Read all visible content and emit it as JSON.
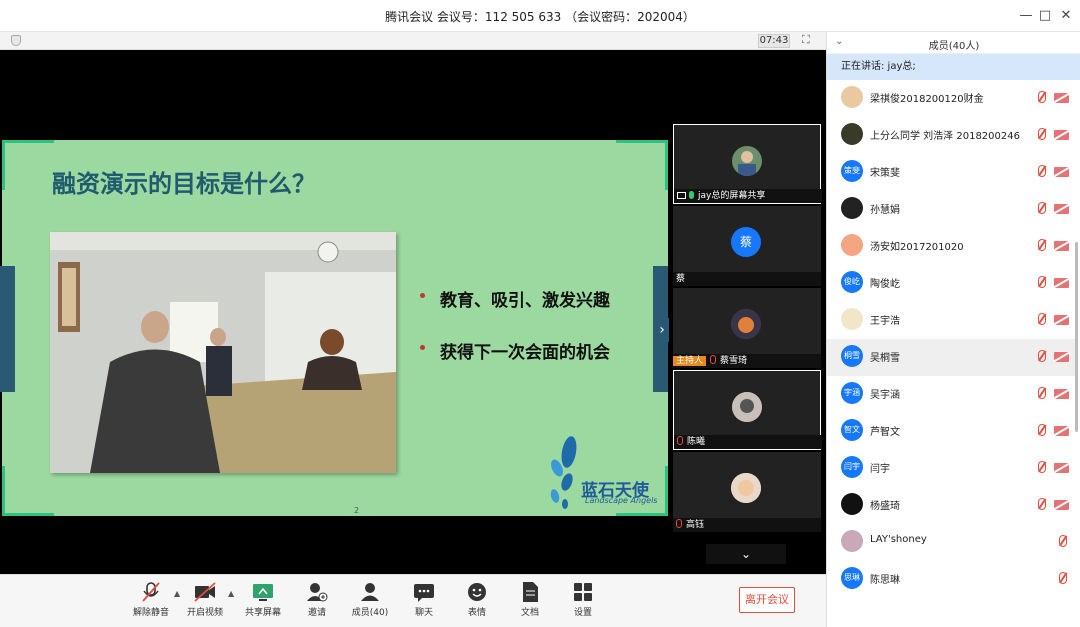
{
  "window": {
    "title": "腾讯会议 会议号：112 505 633 （会议密码：202004）",
    "minimize": "—",
    "maximize": "□",
    "close": "✕"
  },
  "stage": {
    "timer": "07:43",
    "fullscreen": "⛶"
  },
  "slide": {
    "title": "融资演示的目标是什么？",
    "bullets": [
      "教育、吸引、激发兴趣",
      "获得下一次会面的机会"
    ],
    "logo_text": "蓝石天使",
    "logo_sub": "Landscape Angels",
    "page_number": "2"
  },
  "tiles": [
    {
      "name": "jay总的屏幕共享",
      "badge": "",
      "avatar_color": "#6a8f6a"
    },
    {
      "name": "蔡",
      "badge": "",
      "avatar_text": "蔡",
      "avatar_color": "#1677ff"
    },
    {
      "name": "蔡雪琦",
      "badge": "主持人",
      "avatar_color": "#4a4a5a"
    },
    {
      "name": "陈曦",
      "badge": "",
      "avatar_color": "#8a8a8a"
    },
    {
      "name": "高钰",
      "badge": "",
      "avatar_color": "#d8c2a8"
    }
  ],
  "toolbar": {
    "items": [
      {
        "label": "解除静音",
        "icon": "mic-muted-icon"
      },
      {
        "label": "开启视频",
        "icon": "camera-off-icon"
      },
      {
        "label": "共享屏幕",
        "icon": "share-screen-icon"
      },
      {
        "label": "邀请",
        "icon": "invite-icon"
      },
      {
        "label": "成员(40)",
        "icon": "members-icon"
      },
      {
        "label": "聊天",
        "icon": "chat-icon"
      },
      {
        "label": "表情",
        "icon": "emoji-icon"
      },
      {
        "label": "文档",
        "icon": "document-icon"
      },
      {
        "label": "设置",
        "icon": "settings-icon"
      }
    ],
    "leave_label": "离开会议"
  },
  "panel": {
    "title": "成员(40人)",
    "speaking": "正在讲话: jay总;",
    "members": [
      {
        "name": "梁祺俊2018200120财金",
        "avatar_text": "",
        "color": "#e8c9a0",
        "cam": true
      },
      {
        "name": "上分么同学 刘浩泽 2018200246",
        "avatar_text": "",
        "color": "#3a3a2a",
        "cam": true
      },
      {
        "name": "宋策斐",
        "avatar_text": "策斐",
        "color": "#1677ff",
        "cam": true
      },
      {
        "name": "孙慧娟",
        "avatar_text": "",
        "color": "#222222",
        "cam": true
      },
      {
        "name": "汤安如2017201020",
        "avatar_text": "",
        "color": "#f4a582",
        "cam": true
      },
      {
        "name": "陶俊屹",
        "avatar_text": "俊屹",
        "color": "#1677ff",
        "cam": true
      },
      {
        "name": "王宇浩",
        "avatar_text": "",
        "color": "#f2e6c9",
        "cam": true
      },
      {
        "name": "吴桐雪",
        "avatar_text": "桐雪",
        "color": "#1677ff",
        "cam": true,
        "selected": true
      },
      {
        "name": "吴宇涵",
        "avatar_text": "宇涵",
        "color": "#1677ff",
        "cam": true
      },
      {
        "name": "芦智文",
        "avatar_text": "智文",
        "color": "#1677ff",
        "cam": true
      },
      {
        "name": "闫宇",
        "avatar_text": "闫宇",
        "color": "#1677ff",
        "cam": true
      },
      {
        "name": "杨盛琦",
        "avatar_text": "",
        "color": "#111111",
        "cam": true
      },
      {
        "name": "LAY'shoney",
        "avatar_text": "",
        "color": "#c9a8b8",
        "cam": false
      },
      {
        "name": "陈思琳",
        "avatar_text": "思琳",
        "color": "#1677ff",
        "cam": false
      }
    ]
  }
}
